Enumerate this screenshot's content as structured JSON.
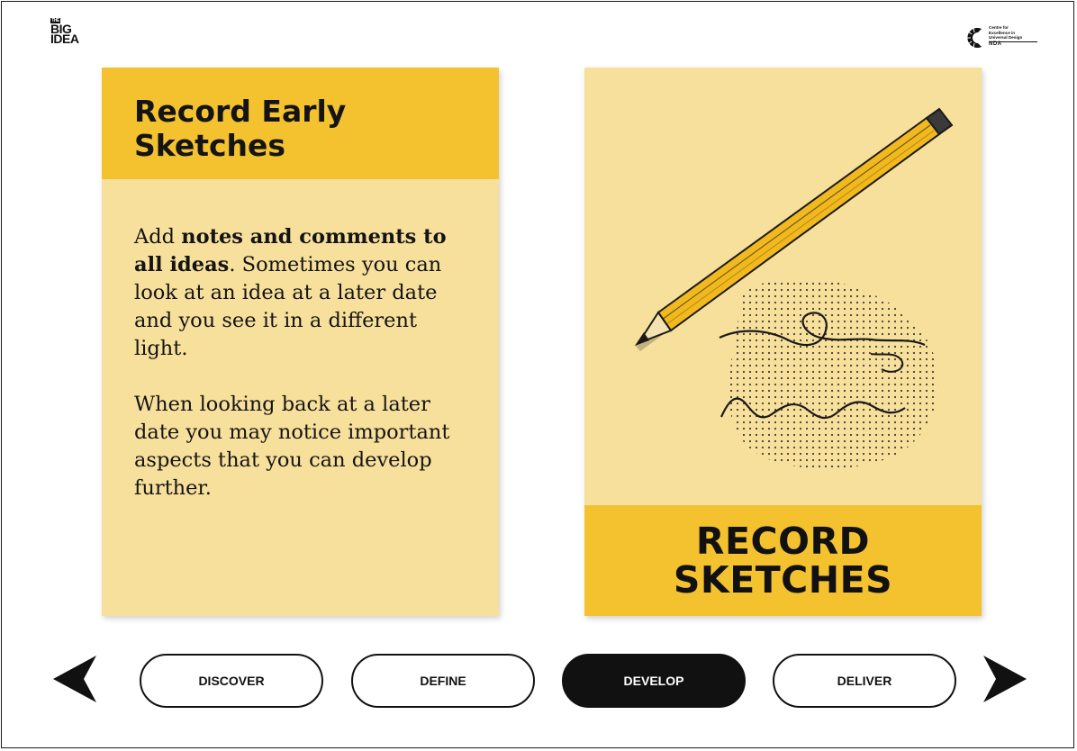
{
  "brand": {
    "logo_the": "THE",
    "logo_big": "BIG",
    "logo_idea": "IDEA",
    "partner_line1": "Centre for",
    "partner_line2": "Excellence in",
    "partner_line3": "Universal Design",
    "partner_org": "NDA"
  },
  "card_left": {
    "title": "Record Early Sketches",
    "para1_lead": "Add ",
    "para1_bold": "notes and comments to all ideas",
    "para1_rest": ". Sometimes you can look at an idea at a later date and you see it in a different light.",
    "para2": "When looking back at a later date you may notice important aspects that you can develop further."
  },
  "card_right": {
    "image_icon": "pencil-sketch-icon",
    "footer_line1": "RECORD",
    "footer_line2": "SKETCHES"
  },
  "nav": {
    "prev_icon": "chevron-left-icon",
    "next_icon": "chevron-right-icon",
    "tabs": [
      {
        "label": "DISCOVER",
        "active": false
      },
      {
        "label": "DEFINE",
        "active": false
      },
      {
        "label": "DEVELOP",
        "active": true
      },
      {
        "label": "DELIVER",
        "active": false
      }
    ]
  },
  "colors": {
    "accent": "#f4c22f",
    "card_bg": "#f7df9c",
    "ink": "#111111"
  }
}
